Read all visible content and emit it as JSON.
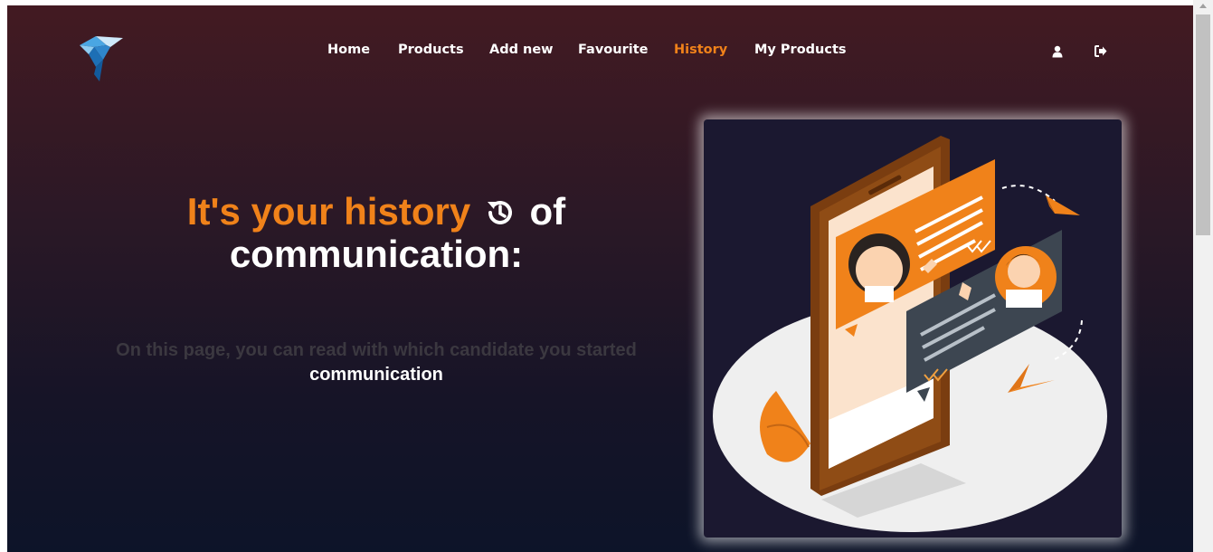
{
  "nav": {
    "items": [
      {
        "label": "Home",
        "active": false
      },
      {
        "label": "Products",
        "active": false
      },
      {
        "label": "Add new",
        "active": false
      },
      {
        "label": "Favourite",
        "active": false
      },
      {
        "label": "History",
        "active": true
      },
      {
        "label": "My Products",
        "active": false
      }
    ]
  },
  "header_icons": [
    "user-icon",
    "logout-icon"
  ],
  "hero": {
    "title_part1": "It's your history",
    "title_icon": "history-icon",
    "title_part2": "of",
    "title_line2": "communication:",
    "subtitle_muted": "On this page, you can read with which candidate you started",
    "subtitle_bright": "communication"
  },
  "colors": {
    "accent": "#f0821a",
    "bg_top": "#431a22",
    "bg_bottom": "#0d1429",
    "text": "#ffffff",
    "muted_text": "#3b3840"
  },
  "illustration": "phone-chat-illustration"
}
